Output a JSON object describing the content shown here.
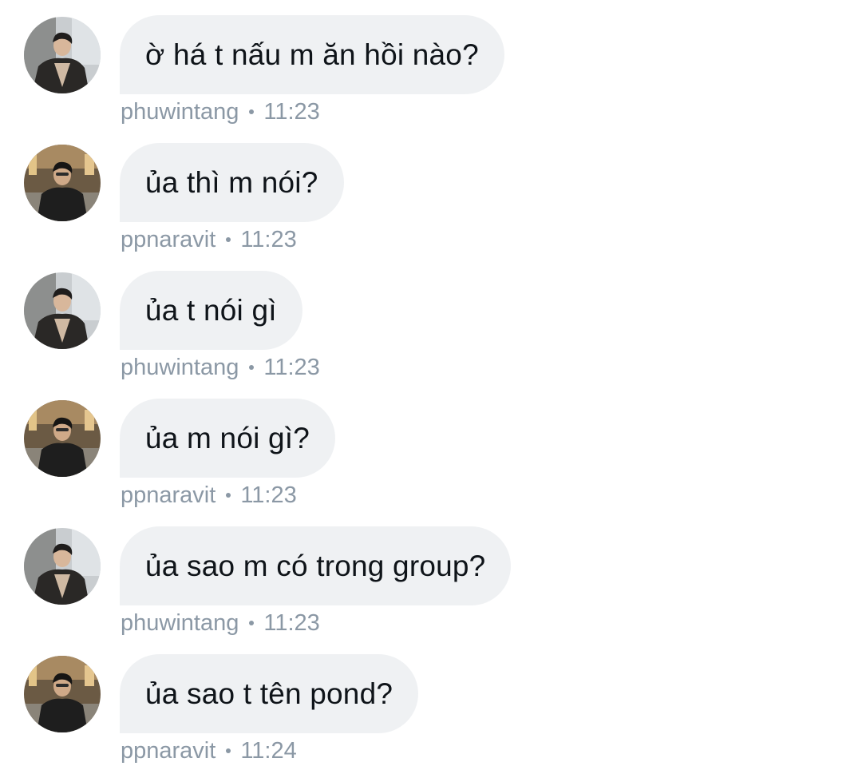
{
  "colors": {
    "bubble_bg": "#eff1f3",
    "message_text": "#0f1419",
    "meta_text": "#8b98a5"
  },
  "messages": [
    {
      "author": "phuwintang",
      "text": "ờ há t nấu m ăn hồi nào?",
      "time": "11:23",
      "avatar": "avatar-phuwintang"
    },
    {
      "author": "ppnaravit",
      "text": "ủa thì m nói?",
      "time": "11:23",
      "avatar": "avatar-ppnaravit"
    },
    {
      "author": "phuwintang",
      "text": "ủa t nói gì",
      "time": "11:23",
      "avatar": "avatar-phuwintang"
    },
    {
      "author": "ppnaravit",
      "text": "ủa m nói gì?",
      "time": "11:23",
      "avatar": "avatar-ppnaravit"
    },
    {
      "author": "phuwintang",
      "text": "ủa sao m có trong group?",
      "time": "11:23",
      "avatar": "avatar-phuwintang"
    },
    {
      "author": "ppnaravit",
      "text": "ủa sao t tên pond?",
      "time": "11:24",
      "avatar": "avatar-ppnaravit"
    }
  ]
}
